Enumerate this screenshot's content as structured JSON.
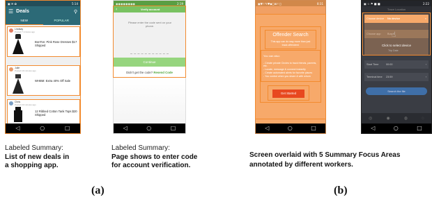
{
  "panel_a": {
    "label": "(a)",
    "shot1": {
      "status_time": "5:14",
      "app_title": "Deals",
      "tabs": [
        "NEW",
        "POPULAR"
      ],
      "deals": [
        {
          "user": "Lindsay",
          "posted": "Posted 7 minutes ago",
          "text": "BonTon: Pink Rose Dresses $17 Shipped"
        },
        {
          "user": "Julie",
          "posted": "Posted 19 minutes ago",
          "text": "WHBM: Extra 40% Off Sale"
        },
        {
          "user": "Chris",
          "posted": "Posted 23 minutes ago",
          "text": "12 Ribbed Cotton Tank Tops $20 Shipped"
        }
      ],
      "caption_line1": "Labeled Summary:",
      "caption_line2": "List of new deals in",
      "caption_line3": "a shopping app."
    },
    "shot2": {
      "status_time": "2:19",
      "header_title": "Verify account",
      "prompt": "Please enter the code sent on your phone.",
      "continue_label": "Continue",
      "resend_text": "Didn't get the code?",
      "resend_link": "Resend Code",
      "caption_line1": "Labeled Summary:",
      "caption_line2": "Page shows to enter code",
      "caption_line3": "for account verification."
    }
  },
  "panel_b": {
    "label": "(b)",
    "shot3": {
      "status_time": "8:31",
      "title": "Offender Search",
      "subtitle": "This app can do way more than just track offenders!",
      "also_heading": "You can also:",
      "bullets": [
        "- Create private Circles to track friends, parents, etc.",
        "- Locate, message & connect instantly",
        "- Create automated alerts for favorite places",
        "- You control when you share & with whom"
      ],
      "button_label": "Get Started"
    },
    "shot4": {
      "status_time": "2:22",
      "header": "Trace Location",
      "row1_label": "Choose device",
      "row1_value": "No device",
      "row2_label": "Choose app",
      "row2_value": "Bus",
      "overlay_text": "Click to select device",
      "row3_label": "Trip Date",
      "row4_label": "Start Time",
      "row4_value": "00:00",
      "row5_label": "Terminal time",
      "row5_value": "23:59",
      "button_label": "Search the file"
    },
    "caption_line1": "Screen overlaid with 5 Summary Focus Areas",
    "caption_line2": "annotated by different workers."
  },
  "nav_icons": [
    "back-icon",
    "home-icon",
    "recents-icon"
  ],
  "colors": {
    "accent_orange": "#f28a2e",
    "deals_teal": "#2c6a77",
    "verify_green": "#79c261"
  }
}
